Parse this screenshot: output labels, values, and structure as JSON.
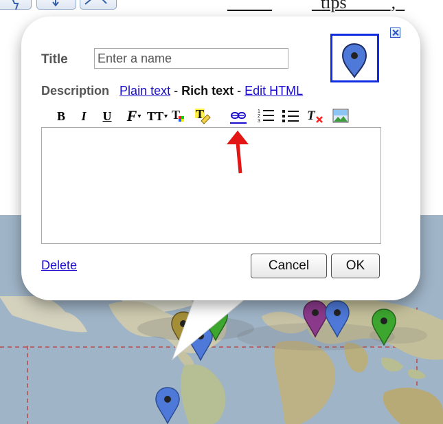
{
  "topbar": {
    "links": [
      "_____",
      "_tips_____,_"
    ]
  },
  "popup": {
    "title_label": "Title",
    "title_placeholder": "Enter a name",
    "description_label": "Description",
    "mode_plain": "Plain text",
    "separator": " - ",
    "mode_rich": "Rich text",
    "mode_html": "Edit HTML",
    "delete_label": "Delete",
    "cancel_label": "Cancel",
    "ok_label": "OK"
  },
  "toolbar": {
    "bold": "B",
    "italic": "I",
    "underline": "U",
    "font": "F",
    "text_size": "TT",
    "text_color": "T",
    "remove_format": "T"
  },
  "colors": {
    "link": "#1a0dcc",
    "accent_border": "#0f2ce0",
    "arrow": "#e31616",
    "marker_blue": "#4e79d8",
    "marker_green": "#3ca62f",
    "marker_purple": "#8b3a8b",
    "marker_olive": "#a48e38",
    "map_water": "#9eb3c6"
  }
}
